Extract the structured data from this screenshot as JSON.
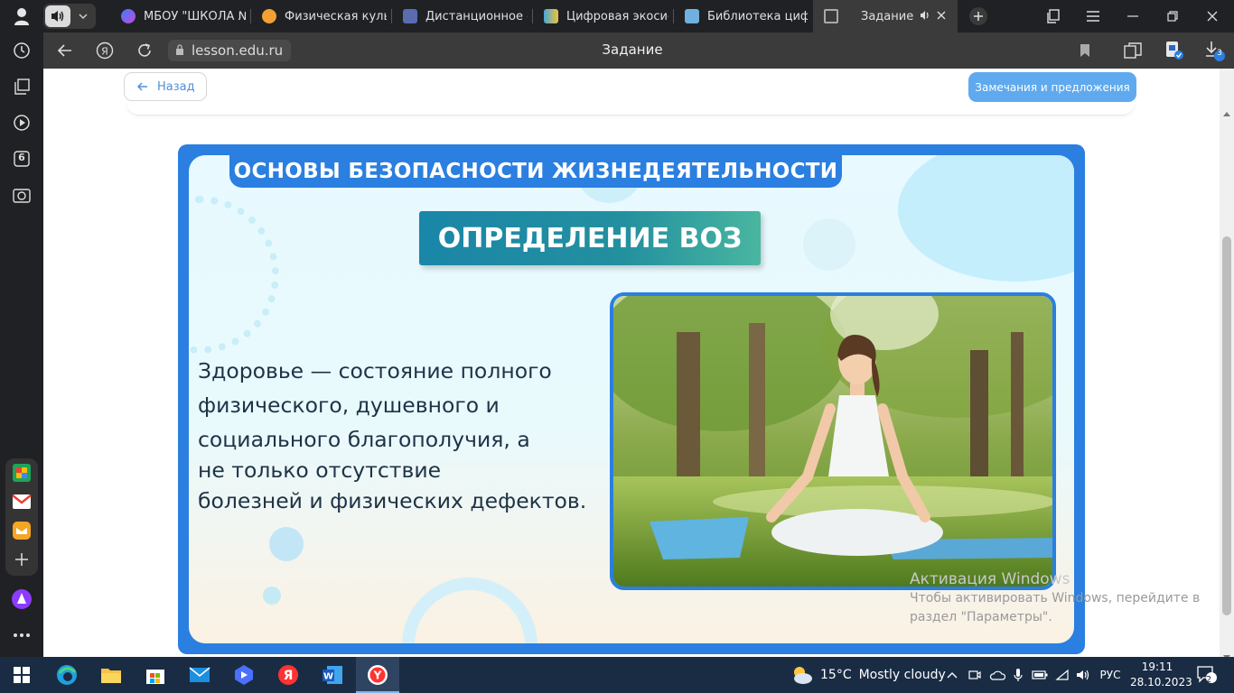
{
  "browser": {
    "tabs": [
      {
        "title": "МБОУ \"ШКОЛА №",
        "color": "#8a4dd6"
      },
      {
        "title": "Физическая культу",
        "color": "#f2a033"
      },
      {
        "title": "Дистанционное об",
        "color": "#5a6bb0"
      },
      {
        "title": "Цифровая экосист",
        "color": "#4aa6d8"
      },
      {
        "title": "Библиотека цифр",
        "color": "#6fb0e0"
      },
      {
        "title": "Задание",
        "color": "#aaaaaa"
      }
    ],
    "url": "lesson.edu.ru",
    "page_title": "Задание",
    "downloads_badge": "3",
    "sidebar_badge": "6"
  },
  "page": {
    "back_label": "Назад",
    "remarks_label": "Замечания и предложения"
  },
  "slide": {
    "header": "ОСНОВЫ БЕЗОПАСНОСТИ ЖИЗНЕДЕЯТЕЛЬНОСТИ",
    "banner": "ОПРЕДЕЛЕНИЕ ВОЗ",
    "definition_lines": [
      "Здоровье — состояние полного",
      "физического, душевного и",
      "социального благополучия, а",
      "не только отсутствие",
      "болезней и физических дефектов."
    ],
    "photo_alt": "woman-meditating-in-park"
  },
  "watermark": {
    "title": "Активация Windows",
    "line1": "Чтобы активировать Windows, перейдите в",
    "line2": "раздел \"Параметры\"."
  },
  "taskbar": {
    "temperature": "15°C",
    "weather": "Mostly cloudy",
    "language": "РУС",
    "time": "19:11",
    "date": "28.10.2023",
    "notifications": "2"
  },
  "colors": {
    "slide_blue": "#2a7fe0",
    "banner_teal": "#1a86a8",
    "button_blue": "#5fa9ee"
  }
}
